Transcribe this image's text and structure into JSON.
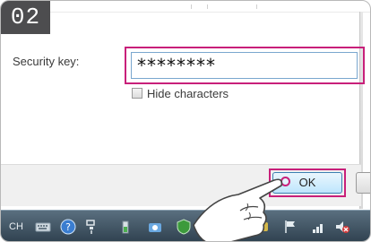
{
  "step_badge": "02",
  "dialog": {
    "security_key_label": "Security key:",
    "security_key_value": "********",
    "hide_characters_label": "Hide characters",
    "hide_characters_checked": false,
    "ok_button_label": "OK"
  },
  "taskbar": {
    "language": "CH",
    "icons": [
      "keyboard-icon",
      "help-icon",
      "pen-icon",
      "battery-icon",
      "app-icon",
      "shield-icon",
      "network-icon",
      "speaker-icon",
      "flag-icon",
      "wifi-icon",
      "volume-muted-icon"
    ]
  },
  "colors": {
    "highlight": "#c8207a",
    "badge_bg": "#4d4d4f",
    "taskbar": "#3d5060"
  }
}
